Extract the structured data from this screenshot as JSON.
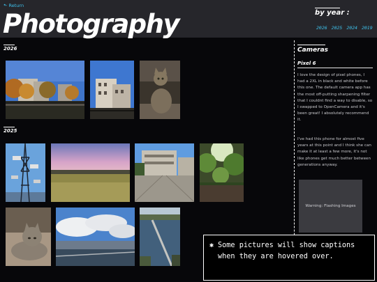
{
  "header": {
    "return_label": "⬑ Return",
    "title": "Photography",
    "by_year_label": "by year :",
    "years": [
      "2026",
      "2025",
      "2024",
      "2019"
    ]
  },
  "sections": [
    {
      "label": "2026"
    },
    {
      "label": "2025"
    }
  ],
  "photos_2026": [
    {
      "name": "photo-autumn-houses",
      "desc": "autumn trees and houses"
    },
    {
      "name": "photo-building-sky",
      "desc": "building against blue sky"
    },
    {
      "name": "photo-tabby-cat",
      "desc": "tabby cat sitting"
    }
  ],
  "photos_2025": [
    {
      "name": "photo-radio-tower",
      "desc": "antenna mast"
    },
    {
      "name": "photo-pink-sky-field",
      "desc": "field under pink sky"
    },
    {
      "name": "photo-concrete-plaza",
      "desc": "modernist building plaza"
    },
    {
      "name": "photo-ivy-wall",
      "desc": "ivy covered wall"
    },
    {
      "name": "photo-cat-lying",
      "desc": "cat lying down"
    },
    {
      "name": "photo-sea-clouds",
      "desc": "sea and clouds"
    },
    {
      "name": "photo-bridge-aerial",
      "desc": "aerial view of bridge"
    }
  ],
  "sidebar": {
    "heading": "Cameras",
    "camera_name": "Pixel 6",
    "paragraphs": [
      "I love the design of pixel phones, I had a 2XL in black and white before this one. The default camera app has the most off-putting sharpening filter that I couldnt find a way to disable, so I swapped to OpenCamera and it's been great! I absolutely recommend it.",
      "I've had this phone for almost five years at this point and I think she can make it at least a few more, it's not like phones get much better between generations anyway."
    ],
    "warning": "Warning: Flashing Images"
  },
  "notice": {
    "icon": "✱",
    "text": "Some pictures will show captions when they are hovered over."
  },
  "colors": {
    "accent": "#3ec3ee",
    "background": "#07070a",
    "header": "#26262b"
  }
}
